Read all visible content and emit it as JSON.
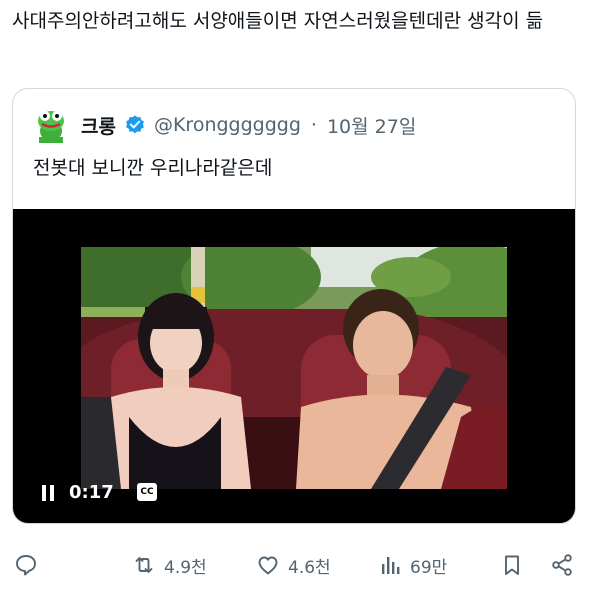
{
  "post": {
    "text": "사대주의안하려고해도 서양애들이면 자연스러웠을텐데란 생각이 듦"
  },
  "quote": {
    "name": "크롱",
    "handle": "@Kronggggggg",
    "dot": "·",
    "date": "10월 27일",
    "text": "전봇대 보니깐 우리나라같은데",
    "video": {
      "timestamp": "0:17",
      "cc_label": "CC"
    }
  },
  "actions": {
    "reply_icon": "speech-bubble-icon",
    "retweets": "4.9천",
    "likes": "4.6천",
    "views": "69만"
  },
  "colors": {
    "text_primary": "#0f1419",
    "text_secondary": "#536471",
    "verified_blue": "#1d9bf0",
    "border": "#cfd9de"
  }
}
